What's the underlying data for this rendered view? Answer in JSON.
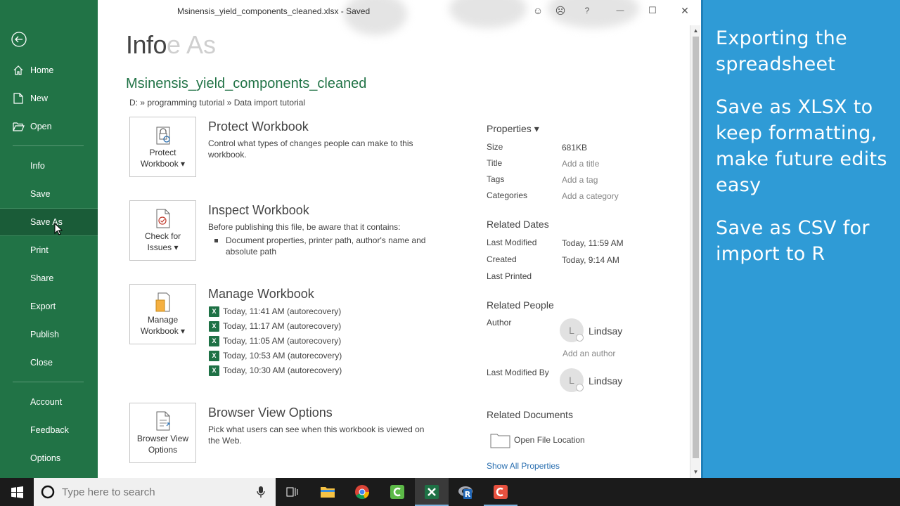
{
  "window": {
    "title": "Msinensis_yield_components_cleaned.xlsx  -  Saved",
    "controls": {
      "smile": "☺",
      "frown": "☹",
      "help": "?",
      "minimize": "—",
      "maximize": "☐",
      "close": "✕"
    }
  },
  "nav": {
    "back_icon": "back-arrow-icon",
    "items": [
      {
        "label": "Home",
        "icon": "home-icon"
      },
      {
        "label": "New",
        "icon": "new-document-icon"
      },
      {
        "label": "Open",
        "icon": "folder-open-icon"
      },
      {
        "label": "Info"
      },
      {
        "label": "Save"
      },
      {
        "label": "Save As",
        "active": true
      },
      {
        "label": "Print"
      },
      {
        "label": "Share"
      },
      {
        "label": "Export"
      },
      {
        "label": "Publish"
      },
      {
        "label": "Close"
      },
      {
        "label": "Account"
      },
      {
        "label": "Feedback"
      },
      {
        "label": "Options"
      }
    ]
  },
  "info": {
    "heading": "Info",
    "ghost_heading": "e As",
    "filename": "Msinensis_yield_components_cleaned",
    "path": "D: » programming tutorial » Data import tutorial",
    "protect": {
      "button": [
        "Protect",
        "Workbook ▾"
      ],
      "title": "Protect Workbook",
      "desc": "Control what types of changes people can make to this workbook."
    },
    "inspect": {
      "button": [
        "Check for",
        "Issues ▾"
      ],
      "title": "Inspect Workbook",
      "desc": "Before publishing this file, be aware that it contains:",
      "bullet": "Document properties, printer path, author's name and absolute path"
    },
    "manage": {
      "button": [
        "Manage",
        "Workbook ▾"
      ],
      "title": "Manage Workbook",
      "versions": [
        "Today, 11:41 AM (autorecovery)",
        "Today, 11:17 AM (autorecovery)",
        "Today, 11:05 AM (autorecovery)",
        "Today, 10:53 AM (autorecovery)",
        "Today, 10:30 AM (autorecovery)"
      ]
    },
    "browser": {
      "button": [
        "Browser View",
        "Options"
      ],
      "title": "Browser View Options",
      "desc": "Pick what users can see when this workbook is viewed on the Web."
    }
  },
  "properties": {
    "heading": "Properties ▾",
    "rows": [
      {
        "label": "Size",
        "value": "681KB",
        "muted": false
      },
      {
        "label": "Title",
        "value": "Add a title",
        "muted": true
      },
      {
        "label": "Tags",
        "value": "Add a tag",
        "muted": true
      },
      {
        "label": "Categories",
        "value": "Add a category",
        "muted": true
      }
    ],
    "dates_heading": "Related Dates",
    "dates": [
      {
        "label": "Last Modified",
        "value": "Today, 11:59 AM"
      },
      {
        "label": "Created",
        "value": "Today, 9:14 AM"
      },
      {
        "label": "Last Printed",
        "value": ""
      }
    ],
    "people_heading": "Related People",
    "author_label": "Author",
    "author_initial": "L",
    "author_name": "Lindsay",
    "add_author": "Add an author",
    "modified_by_label": "Last Modified By",
    "modified_by_initial": "L",
    "modified_by_name": "Lindsay",
    "documents_heading": "Related Documents",
    "open_location": "Open File Location",
    "show_all": "Show All Properties"
  },
  "annotation": {
    "lines": [
      "Exporting the spreadsheet",
      "Save as XLSX to keep formatting, make future edits easy",
      "Save as CSV for import to R"
    ]
  },
  "taskbar": {
    "search_placeholder": "Type here to search",
    "apps": [
      "task-view-icon",
      "file-explorer-icon",
      "chrome-icon",
      "camtasia-icon",
      "excel-icon",
      "r-icon",
      "recorder-icon"
    ]
  }
}
